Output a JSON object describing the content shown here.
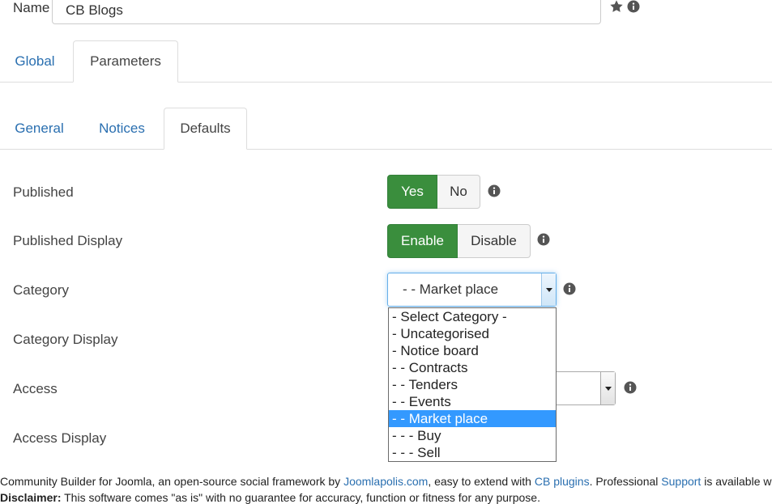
{
  "name_field": {
    "label": "Name",
    "value": "CB Blogs"
  },
  "header_icons": {
    "star": "star-icon",
    "info": "info-icon"
  },
  "top_tabs": [
    {
      "label": "Global",
      "active": false
    },
    {
      "label": "Parameters",
      "active": true
    }
  ],
  "sub_tabs": [
    {
      "label": "General",
      "active": false
    },
    {
      "label": "Notices",
      "active": false
    },
    {
      "label": "Defaults",
      "active": true
    }
  ],
  "fields": {
    "published": {
      "label": "Published",
      "options": [
        "Yes",
        "No"
      ],
      "selected": "Yes"
    },
    "published_display": {
      "label": "Published Display",
      "options": [
        "Enable",
        "Disable"
      ],
      "selected": "Enable"
    },
    "category": {
      "label": "Category",
      "value": "- - Market place"
    },
    "category_display": {
      "label": "Category Display"
    },
    "access": {
      "label": "Access"
    },
    "access_display": {
      "label": "Access Display"
    }
  },
  "category_options": [
    "- Select Category -",
    "- Uncategorised",
    "- Notice board",
    "- - Contracts",
    "- - Tenders",
    "- - Events",
    "- - Market place",
    "- - - Buy",
    "- - - Sell"
  ],
  "category_selected_index": 6,
  "colors": {
    "accent_green": "#3a8e3d",
    "link_blue": "#2a6fb0",
    "selection_blue": "#3399ff"
  },
  "footer": {
    "text1": "Community Builder for Joomla, an open-source social framework by ",
    "link1": "Joomlapolis.com",
    "text2": ", easy to extend with ",
    "link2": "CB plugins",
    "text3": ". Professional ",
    "link3": "Support",
    "text4": " is available w",
    "disclaimer_label": "Disclaimer:",
    "disclaimer_text": " This software comes \"as is\" with no guarantee for accuracy, function or fitness for any purpose."
  }
}
